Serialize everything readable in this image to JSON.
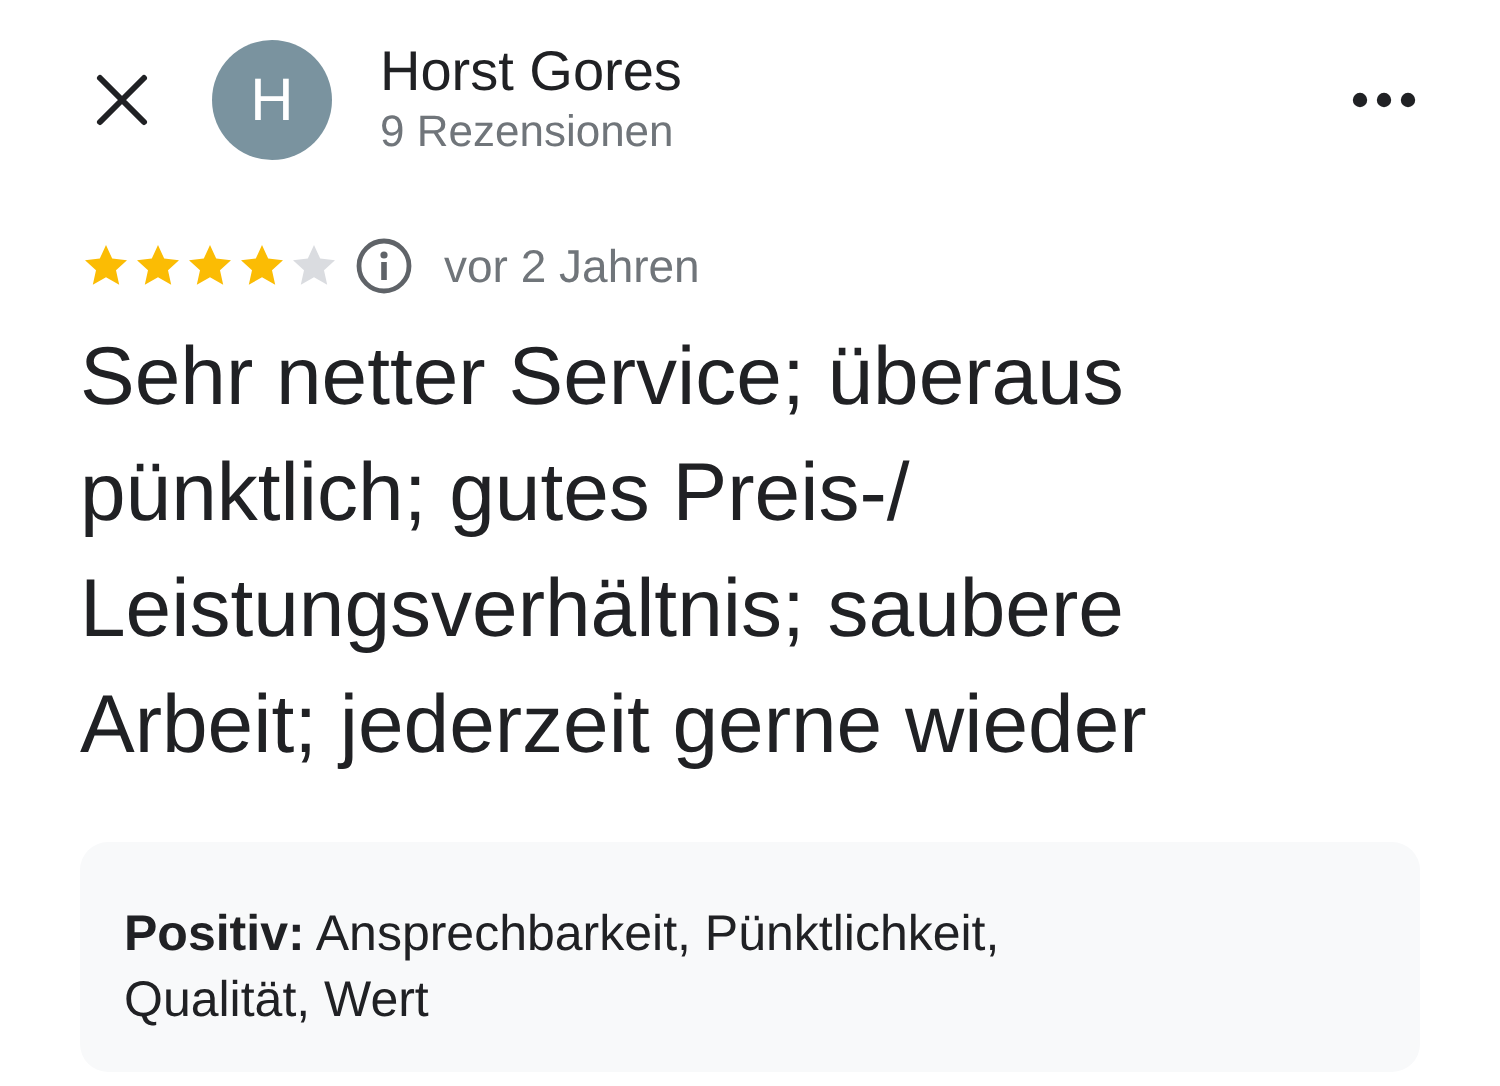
{
  "reviewer": {
    "initial": "H",
    "name": "Horst Gores",
    "review_count": "9 Rezensionen"
  },
  "review": {
    "stars": 4,
    "time": "vor 2 Jahren",
    "text": "Sehr netter Service; überaus pünktlich; gutes Preis-/ Leistungsverhältnis; saubere Arbeit; jederzeit gerne wieder"
  },
  "details": {
    "text": "**Positiv:** Ansprechbarkeit, Pünktlichkeit, Qualität, Wert"
  }
}
